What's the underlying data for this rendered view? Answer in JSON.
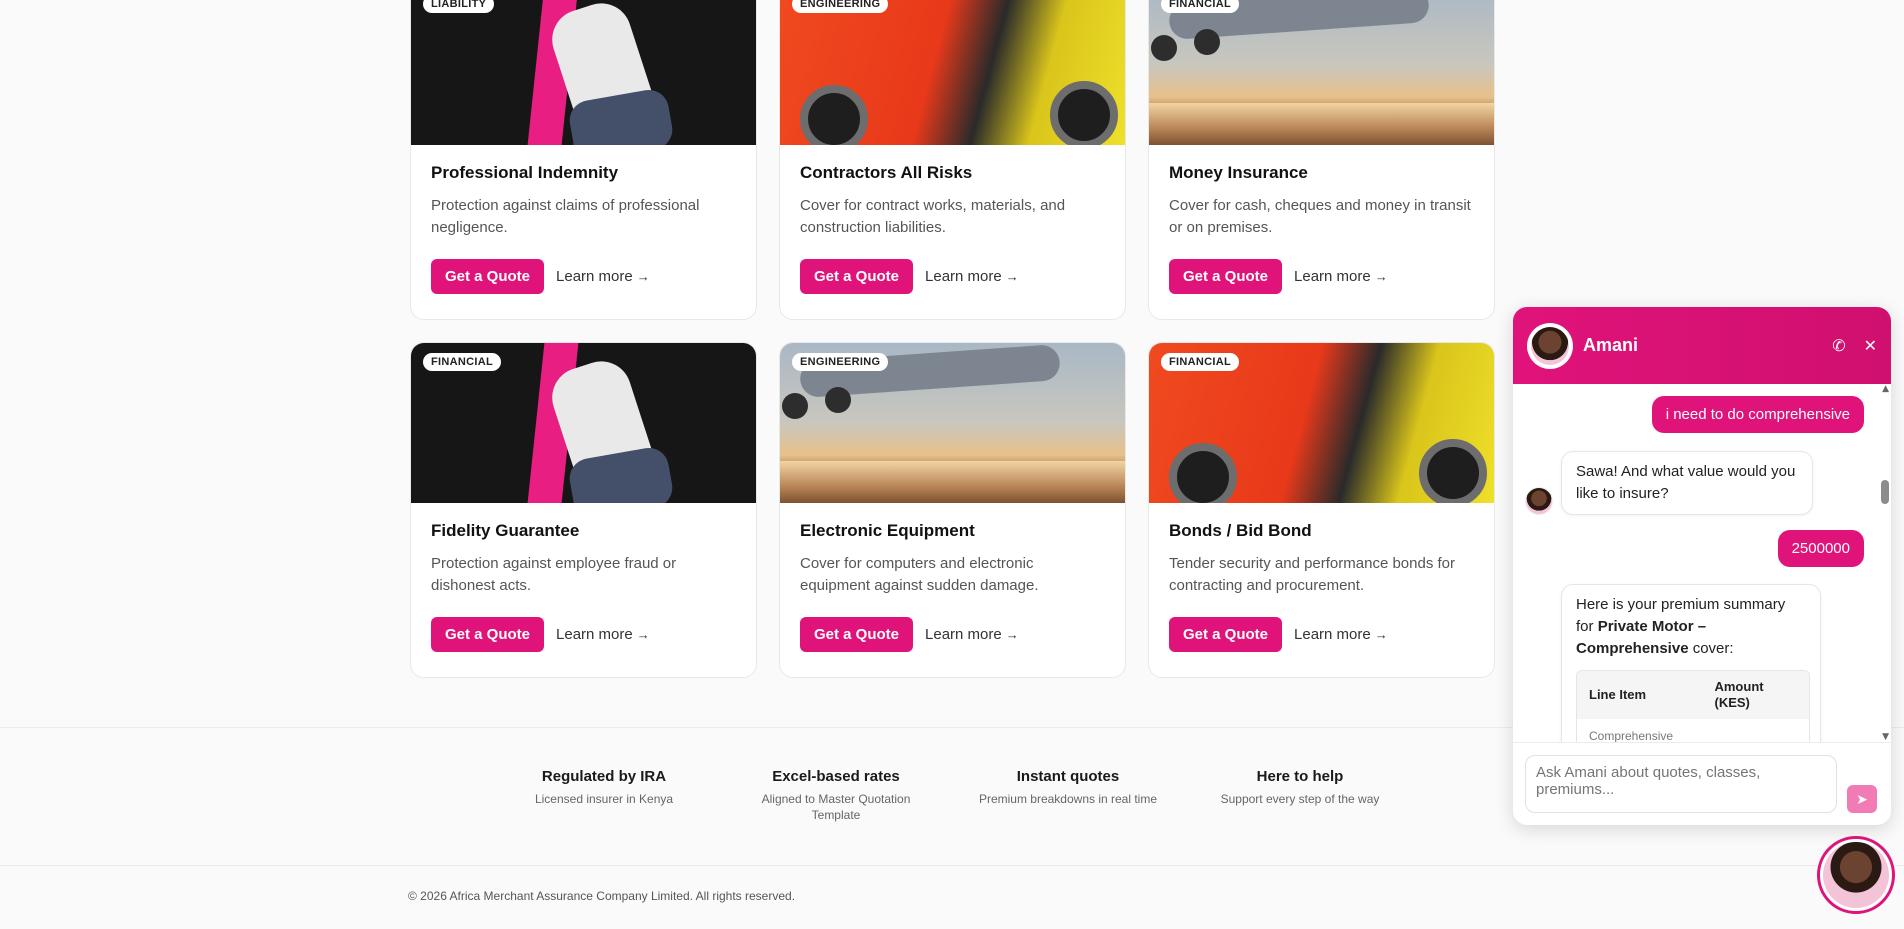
{
  "cards": [
    {
      "badge": "LIABILITY",
      "title": "Professional Indemnity",
      "desc": "Protection against claims of professional negligence.",
      "quote": "Get a Quote",
      "learn": "Learn more"
    },
    {
      "badge": "ENGINEERING",
      "title": "Contractors All Risks",
      "desc": "Cover for contract works, materials, and construction liabilities.",
      "quote": "Get a Quote",
      "learn": "Learn more"
    },
    {
      "badge": "FINANCIAL",
      "title": "Money Insurance",
      "desc": "Cover for cash, cheques and money in transit or on premises.",
      "quote": "Get a Quote",
      "learn": "Learn more"
    },
    {
      "badge": "FINANCIAL",
      "title": "Fidelity Guarantee",
      "desc": "Protection against employee fraud or dishonest acts.",
      "quote": "Get a Quote",
      "learn": "Learn more"
    },
    {
      "badge": "ENGINEERING",
      "title": "Electronic Equipment",
      "desc": "Cover for computers and electronic equipment against sudden damage.",
      "quote": "Get a Quote",
      "learn": "Learn more"
    },
    {
      "badge": "FINANCIAL",
      "title": "Bonds / Bid Bond",
      "desc": "Tender security and performance bonds for contracting and procurement.",
      "quote": "Get a Quote",
      "learn": "Learn more"
    }
  ],
  "features": [
    {
      "title": "Regulated by IRA",
      "sub": "Licensed insurer in Kenya"
    },
    {
      "title": "Excel-based rates",
      "sub": "Aligned to Master Quotation Template"
    },
    {
      "title": "Instant quotes",
      "sub": "Premium breakdowns in real time"
    },
    {
      "title": "Here to help",
      "sub": "Support every step of the way"
    }
  ],
  "footer": {
    "copyright": "© 2026 Africa Merchant Assurance Company Limited. All rights reserved."
  },
  "chat": {
    "name": "Amani",
    "messages": {
      "user1": "i need to do comprehensive",
      "bot1": "Sawa! And what value would you like to insure?",
      "user2": "2500000",
      "bot2_pre": "Here is your premium summary for ",
      "bot2_bold": "Private Motor – Comprehensive",
      "bot2_post": " cover:",
      "table_col1": "Line Item",
      "table_col2": "Amount (KES)",
      "table_row1": "Comprehensive"
    },
    "input_placeholder": "Ask Amani about quotes, classes, premiums..."
  },
  "colors": {
    "accent": "#e0137a"
  },
  "icons": [
    "arrow-right-icon",
    "phone-icon",
    "close-icon",
    "send-icon",
    "chevron-up-icon",
    "chevron-down-icon"
  ]
}
